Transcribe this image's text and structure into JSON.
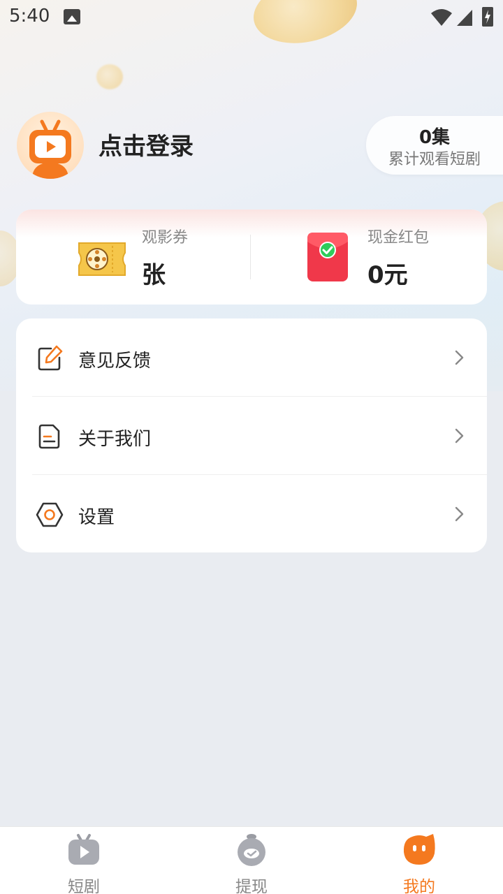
{
  "status_bar": {
    "time": "5:40"
  },
  "profile": {
    "login_text": "点击登录",
    "watch_count": "0集",
    "watch_label": "累计观看短剧"
  },
  "wallet": {
    "ticket_label": "观影券",
    "ticket_value": "张",
    "cash_label": "现金红包",
    "cash_value": "0元"
  },
  "menu": {
    "items": [
      {
        "label": "意见反馈",
        "icon": "edit-icon"
      },
      {
        "label": "关于我们",
        "icon": "document-icon"
      },
      {
        "label": "设置",
        "icon": "settings-icon"
      }
    ]
  },
  "bottom_nav": {
    "items": [
      {
        "label": "短剧",
        "icon": "tv-icon",
        "active": false
      },
      {
        "label": "提现",
        "icon": "withdraw-icon",
        "active": false
      },
      {
        "label": "我的",
        "icon": "me-icon",
        "active": true
      }
    ]
  },
  "colors": {
    "accent": "#f4791f",
    "background": "#e9ecf1"
  }
}
